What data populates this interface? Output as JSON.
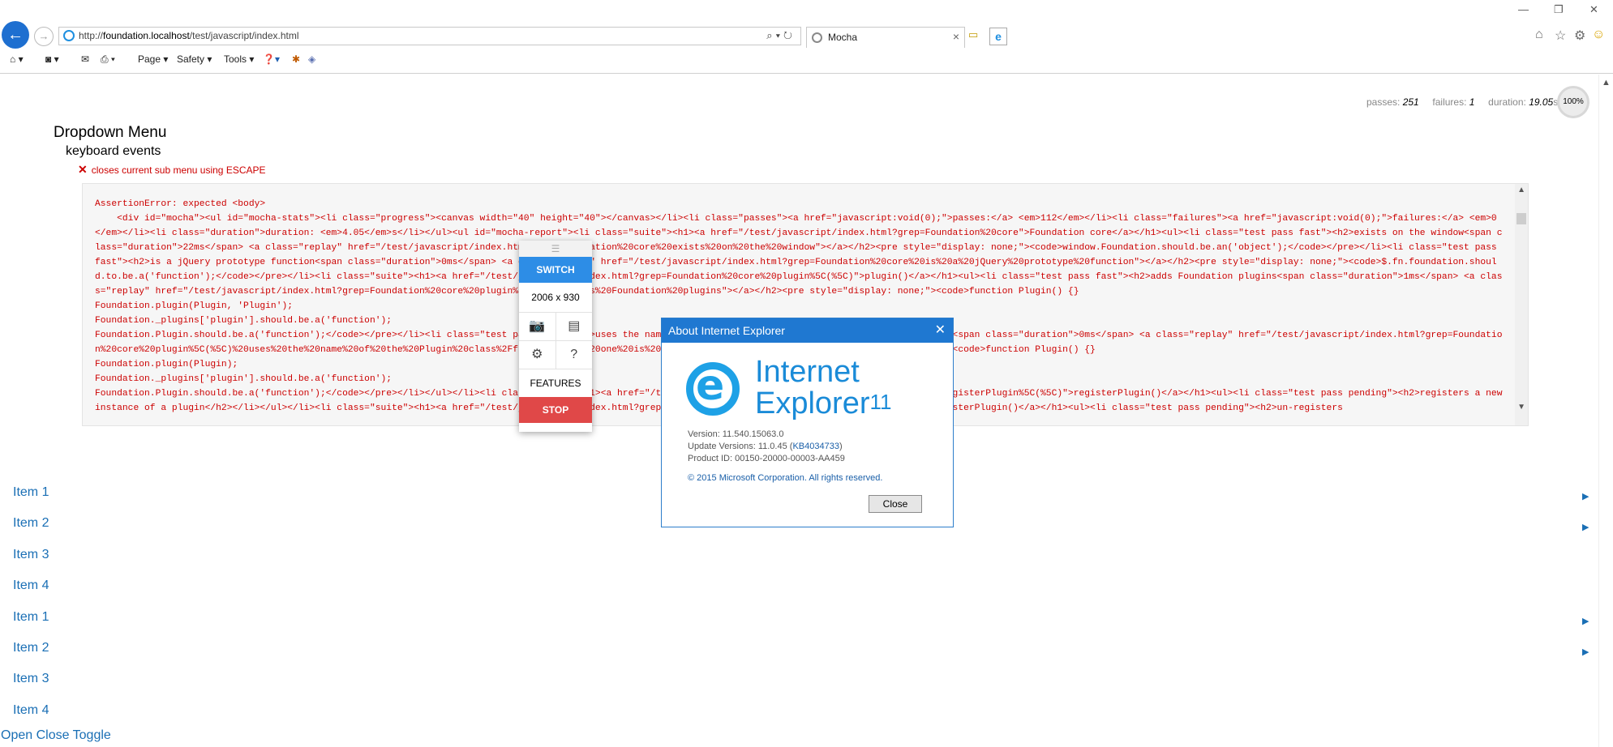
{
  "browser": {
    "url_prefix": "http://",
    "url_host": "foundation.localhost",
    "url_path": "/test/javascript/index.html",
    "tab_title": "Mocha",
    "tab_close": "×",
    "commands": [
      "Page ▾",
      "Safety ▾",
      "Tools ▾"
    ]
  },
  "stats": {
    "passes_label": "passes:",
    "passes": "251",
    "failures_label": "failures:",
    "failures": "1",
    "duration_label": "duration:",
    "duration": "19.05",
    "duration_unit": "s",
    "progress": "100%"
  },
  "report": {
    "suite": "Dropdown Menu",
    "subsuite": "keyboard events",
    "failed_test": "closes current sub menu using ESCAPE",
    "error_text": "AssertionError: expected <body>\n    <div id=\"mocha\"><ul id=\"mocha-stats\"><li class=\"progress\"><canvas width=\"40\" height=\"40\"></canvas></li><li class=\"passes\"><a href=\"javascript:void(0);\">passes:</a> <em>112</em></li><li class=\"failures\"><a href=\"javascript:void(0);\">failures:</a> <em>0</em></li><li class=\"duration\">duration: <em>4.05</em>s</li></ul><ul id=\"mocha-report\"><li class=\"suite\"><h1><a href=\"/test/javascript/index.html?grep=Foundation%20core\">Foundation core</a></h1><ul><li class=\"test pass fast\"><h2>exists on the window<span class=\"duration\">22ms</span> <a class=\"replay\" href=\"/test/javascript/index.html?grep=Foundation%20core%20exists%20on%20the%20window\"></a></h2><pre style=\"display: none;\"><code>window.Foundation.should.be.an('object');</code></pre></li><li class=\"test pass fast\"><h2>is a jQuery prototype function<span class=\"duration\">0ms</span> <a class=\"replay\" href=\"/test/javascript/index.html?grep=Foundation%20core%20is%20a%20jQuery%20prototype%20function\"></a></h2><pre style=\"display: none;\"><code>$.fn.foundation.should.to.be.a('function');</code></pre></li><li class=\"suite\"><h1><a href=\"/test/javascript/index.html?grep=Foundation%20core%20plugin%5C(%5C)\">plugin()</a></h1><ul><li class=\"test pass fast\"><h2>adds Foundation plugins<span class=\"duration\">1ms</span> <a class=\"replay\" href=\"/test/javascript/index.html?grep=Foundation%20core%20plugin%5C(%5C)%20adds%20Foundation%20plugins\"></a></h2><pre style=\"display: none;\"><code>function Plugin() {}\nFoundation.plugin(Plugin, 'Plugin');\nFoundation._plugins['plugin'].should.be.a('function');\nFoundation.Plugin.should.be.a('function');</code></pre></li><li class=\"test pass fast\"><h2>uses the name of the Plugin class/function if one is not provided<span class=\"duration\">0ms</span> <a class=\"replay\" href=\"/test/javascript/index.html?grep=Foundation%20core%20plugin%5C(%5C)%20uses%20the%20name%20of%20the%20Plugin%20class%2Ffunction%20if%20one%20is%20not%20provided\"></a></h2><pre style=\"display: none;\"><code>function Plugin() {}\nFoundation.plugin(Plugin);\nFoundation._plugins['plugin'].should.be.a('function');\nFoundation.Plugin.should.be.a('function');</code></pre></li></ul></li><li class=\"suite\"><h1><a href=\"/test/javascript/index.html?grep=Foundation%20core%20registerPlugin%5C(%5C)\">registerPlugin()</a></h1><ul><li class=\"test pass pending\"><h2>registers a new instance of a plugin</h2></li></ul></li><li class=\"suite\"><h1><a href=\"/test/javascript/index.html?grep=Foundation%20core%20unregisterPlugin%5C(%5C)\">unregisterPlugin()</a></h1><ul><li class=\"test pass pending\"><h2>un-registers"
  },
  "menu_items": [
    "Item 1",
    "Item 2",
    "Item 3",
    "Item 4",
    "Item 1",
    "Item 2",
    "Item 3",
    "Item 4"
  ],
  "toggle_label": "Open Close Toggle",
  "widget": {
    "switch": "SWITCH",
    "dimensions": "2006 x 930",
    "features": "FEATURES",
    "stop": "STOP"
  },
  "about_dialog": {
    "title": "About Internet Explorer",
    "brand_line1": "Internet",
    "brand_line2": "Explorer",
    "brand_version": "11",
    "version_line": "Version: 11.540.15063.0",
    "update_label": "Update Versions: 11.0.45 (",
    "update_kb": "KB4034733",
    "update_close": ")",
    "product_line": "Product ID: 00150-20000-00003-AA459",
    "copyright": "© 2015 Microsoft Corporation. All rights reserved.",
    "close_button": "Close"
  },
  "colors": {
    "ie_blue": "#1f78d1",
    "link_blue": "#1a6fb5",
    "error_red": "#cc0000",
    "widget_switch": "#2d8de6",
    "widget_stop": "#e04848"
  }
}
